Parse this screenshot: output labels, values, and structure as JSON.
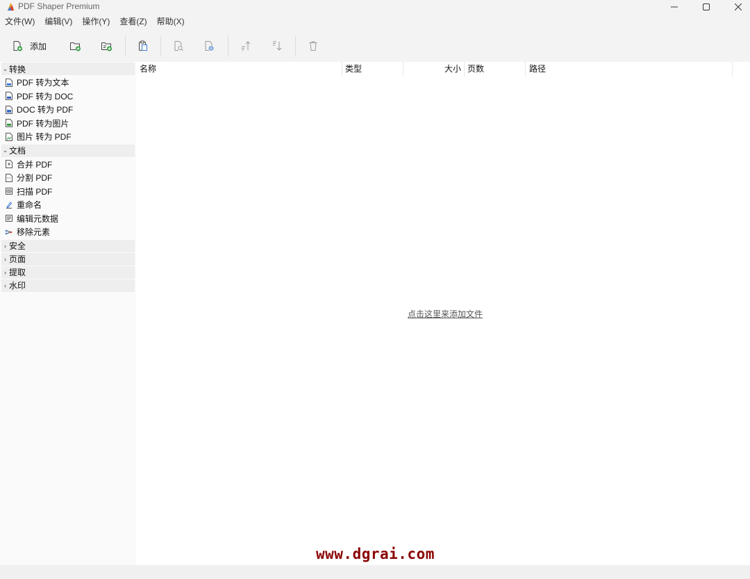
{
  "window": {
    "title": "PDF Shaper Premium",
    "controls": {
      "minimize": "—",
      "maximize": "☐",
      "close": "✕"
    }
  },
  "menu": [
    "文件(W)",
    "编辑(V)",
    "操作(Y)",
    "查看(Z)",
    "帮助(X)"
  ],
  "toolbar": {
    "add_label": "添加",
    "buttons": [
      "add-file",
      "add-folder",
      "add-folder-subdirs",
      "paste",
      "preview",
      "properties",
      "move-up",
      "move-down",
      "delete"
    ]
  },
  "sidebar": {
    "groups": [
      {
        "label": "转换",
        "expanded": true,
        "items": [
          {
            "label": "PDF 转为文本",
            "icon": "pdf-to-text-icon"
          },
          {
            "label": "PDF 转为 DOC",
            "icon": "pdf-to-doc-icon"
          },
          {
            "label": "DOC 转为 PDF",
            "icon": "doc-to-pdf-icon"
          },
          {
            "label": "PDF 转为图片",
            "icon": "pdf-to-image-icon"
          },
          {
            "label": "图片 转为 PDF",
            "icon": "image-to-pdf-icon"
          }
        ]
      },
      {
        "label": "文档",
        "expanded": true,
        "items": [
          {
            "label": "合并 PDF",
            "icon": "merge-icon"
          },
          {
            "label": "分割 PDF",
            "icon": "split-icon"
          },
          {
            "label": "扫描 PDF",
            "icon": "scan-icon"
          },
          {
            "label": "重命名",
            "icon": "rename-icon"
          },
          {
            "label": "编辑元数据",
            "icon": "metadata-icon"
          },
          {
            "label": "移除元素",
            "icon": "remove-elements-icon"
          }
        ]
      },
      {
        "label": "安全",
        "expanded": false,
        "items": []
      },
      {
        "label": "页面",
        "expanded": false,
        "items": []
      },
      {
        "label": "提取",
        "expanded": false,
        "items": []
      },
      {
        "label": "水印",
        "expanded": false,
        "items": []
      }
    ]
  },
  "table": {
    "columns": [
      "名称",
      "类型",
      "大小",
      "页数",
      "路径"
    ],
    "rows": []
  },
  "empty_state": {
    "link_text": "点击这里来添加文件"
  },
  "watermark": "www.dgrai.com",
  "colors": {
    "accent_green": "#2e9b3e",
    "watermark": "#8b0000"
  }
}
